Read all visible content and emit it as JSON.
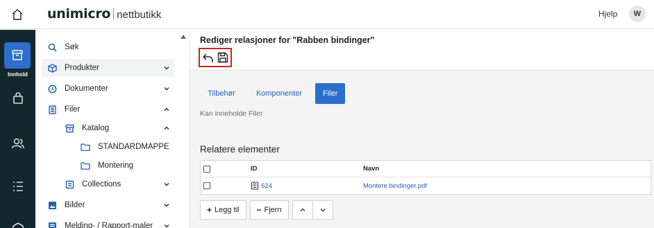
{
  "brand": {
    "name": "unimicro",
    "product": "nettbutikk"
  },
  "header": {
    "help_label": "Hjelp",
    "avatar_initial": "W"
  },
  "rail": {
    "active_label": "Innhold"
  },
  "nav": {
    "items": [
      {
        "label": "Søk",
        "icon": "search-icon"
      },
      {
        "label": "Produkter",
        "icon": "cube-icon",
        "expanded": false,
        "selected": true
      },
      {
        "label": "Dokumenter",
        "icon": "clock-icon",
        "expanded": false
      },
      {
        "label": "Filer",
        "icon": "file-list-icon",
        "expanded": true
      },
      {
        "label": "Katalog",
        "icon": "archive-icon",
        "expanded": true
      },
      {
        "label": "STANDARDMAPPE",
        "icon": "folder-icon"
      },
      {
        "label": "Montering",
        "icon": "folder-icon"
      },
      {
        "label": "Collections",
        "icon": "collection-icon",
        "expanded": false
      },
      {
        "label": "Bilder",
        "icon": "image-icon",
        "expanded": false
      },
      {
        "label": "Melding- / Rapport-maler",
        "icon": "template-icon",
        "expanded": false
      }
    ]
  },
  "page": {
    "title": "Rediger relasjoner for \"Rabben bindinger\""
  },
  "tabs": [
    {
      "label": "Tilbehør",
      "active": false
    },
    {
      "label": "Komponenter",
      "active": false
    },
    {
      "label": "Filer",
      "active": true
    }
  ],
  "hint": "Kan inneholde Filer",
  "related": {
    "title": "Relatere elementer",
    "columns": {
      "id": "ID",
      "name": "Navn"
    },
    "rows": [
      {
        "id": "624",
        "name": "Montere bindinger.pdf",
        "checked": false
      }
    ]
  },
  "buttons": {
    "add": "Legg til",
    "remove": "Fjern"
  },
  "colors": {
    "accent": "#2c6ecb",
    "rail": "#13272e",
    "link": "#2462b0",
    "highlight": "#d42020"
  }
}
